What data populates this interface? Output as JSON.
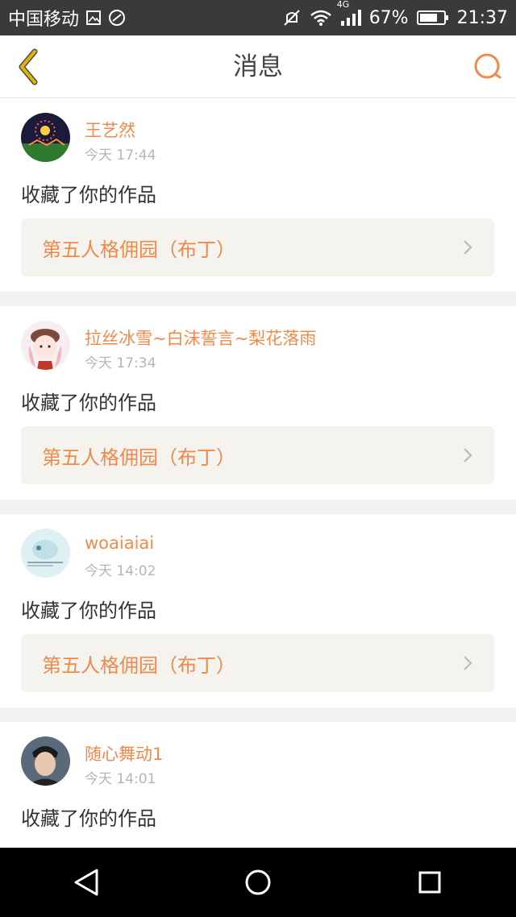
{
  "status_bar": {
    "carrier": "中国移动",
    "network": "4G",
    "battery": "67%",
    "time": "21:37"
  },
  "header": {
    "title": "消息",
    "back_icon": "chevron-left-icon",
    "search_icon": "search-icon"
  },
  "colors": {
    "accent": "#f08a4b",
    "back_icon": "#e5b400",
    "link_bg": "#f4f3ee"
  },
  "messages": [
    {
      "user": "王艺然",
      "time": "今天 17:44",
      "action": "收藏了你的作品",
      "work": "第五人格佣园（布丁）"
    },
    {
      "user": "拉丝冰雪~白沫誓言~梨花落雨",
      "time": "今天 17:34",
      "action": "收藏了你的作品",
      "work": "第五人格佣园（布丁）"
    },
    {
      "user": "woaiaiai",
      "time": "今天 14:02",
      "action": "收藏了你的作品",
      "work": "第五人格佣园（布丁）"
    },
    {
      "user": "随心舞动1",
      "time": "今天 14:01",
      "action": "收藏了你的作品",
      "work": ""
    }
  ]
}
